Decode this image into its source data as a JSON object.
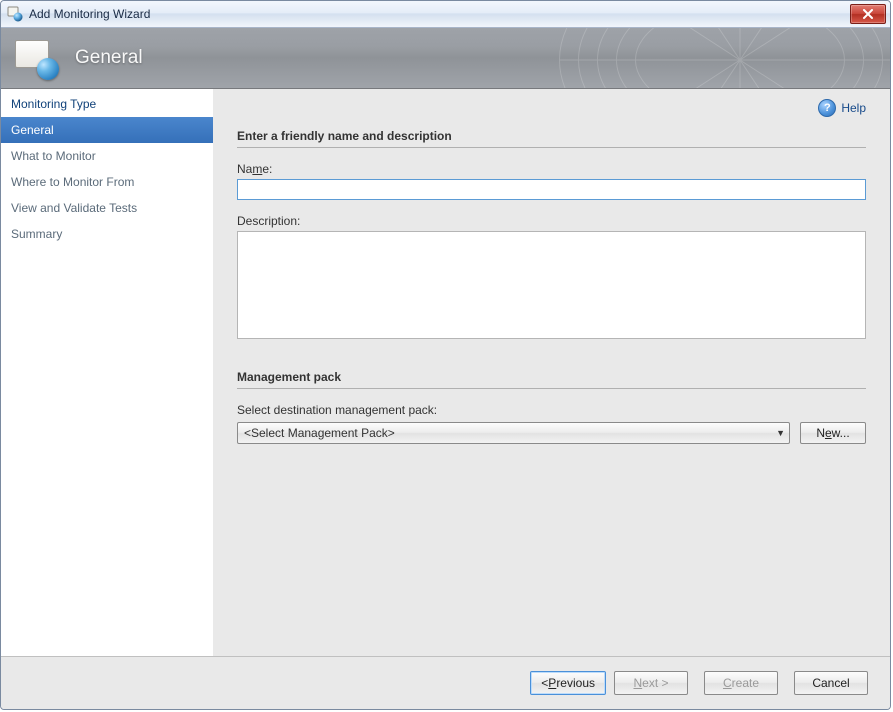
{
  "window": {
    "title": "Add Monitoring Wizard"
  },
  "banner": {
    "title": "General"
  },
  "sidebar": {
    "items": [
      {
        "label": "Monitoring Type"
      },
      {
        "label": "General"
      },
      {
        "label": "What to Monitor"
      },
      {
        "label": "Where to Monitor From"
      },
      {
        "label": "View and Validate Tests"
      },
      {
        "label": "Summary"
      }
    ]
  },
  "help": {
    "label": "Help",
    "icon_char": "?"
  },
  "form": {
    "section1_title": "Enter a friendly name and description",
    "name_label_full": "Name:",
    "name_value": "",
    "description_label": "Description:",
    "description_value": "",
    "section2_title": "Management pack",
    "select_mp_label": "Select destination management pack:",
    "mp_select_text": "<Select Management Pack>",
    "new_button": "New..."
  },
  "footer": {
    "previous": "< Previous",
    "next": "Next >",
    "create": "Create",
    "cancel": "Cancel"
  }
}
